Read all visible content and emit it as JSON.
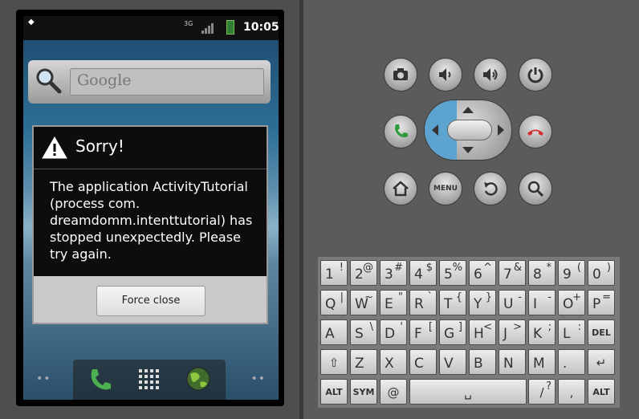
{
  "statusbar": {
    "network": "3G",
    "time": "10:05"
  },
  "search": {
    "placeholder": "Google"
  },
  "dialog": {
    "title": "Sorry!",
    "message": "The application ActivityTutorial (process com. dreamdomm.intenttutorial) has stopped unexpectedly. Please try again.",
    "button": "Force close"
  },
  "controls": {
    "menu_label": "MENU"
  },
  "keyboard": {
    "row1": [
      {
        "main": "1",
        "alt": "!"
      },
      {
        "main": "2",
        "alt": "@"
      },
      {
        "main": "3",
        "alt": "#"
      },
      {
        "main": "4",
        "alt": "$"
      },
      {
        "main": "5",
        "alt": "%"
      },
      {
        "main": "6",
        "alt": "^"
      },
      {
        "main": "7",
        "alt": "&"
      },
      {
        "main": "8",
        "alt": "*"
      },
      {
        "main": "9",
        "alt": "("
      },
      {
        "main": "0",
        "alt": ")"
      }
    ],
    "row2": [
      {
        "main": "Q",
        "alt": "|"
      },
      {
        "main": "W",
        "alt": "~"
      },
      {
        "main": "E",
        "alt": "\""
      },
      {
        "main": "R",
        "alt": "`"
      },
      {
        "main": "T",
        "alt": "{"
      },
      {
        "main": "Y",
        "alt": "}"
      },
      {
        "main": "U",
        "alt": "-"
      },
      {
        "main": "I",
        "alt": "-"
      },
      {
        "main": "O",
        "alt": "+"
      },
      {
        "main": "P",
        "alt": "="
      }
    ],
    "row3": [
      {
        "main": "A",
        "alt": ""
      },
      {
        "main": "S",
        "alt": "\\"
      },
      {
        "main": "D",
        "alt": "'"
      },
      {
        "main": "F",
        "alt": "["
      },
      {
        "main": "G",
        "alt": "]"
      },
      {
        "main": "H",
        "alt": "<"
      },
      {
        "main": "J",
        "alt": ">"
      },
      {
        "main": "K",
        "alt": ";"
      },
      {
        "main": "L",
        "alt": ":"
      },
      {
        "main": "DEL",
        "alt": ""
      }
    ],
    "row4": [
      {
        "main": "⇧",
        "alt": ""
      },
      {
        "main": "Z",
        "alt": ""
      },
      {
        "main": "X",
        "alt": ""
      },
      {
        "main": "C",
        "alt": ""
      },
      {
        "main": "V",
        "alt": ""
      },
      {
        "main": "B",
        "alt": ""
      },
      {
        "main": "N",
        "alt": ""
      },
      {
        "main": "M",
        "alt": ""
      },
      {
        "main": ".",
        "alt": ""
      },
      {
        "main": "↵",
        "alt": ""
      }
    ],
    "row5": {
      "alt_left": "ALT",
      "sym": "SYM",
      "at": "@",
      "space": "␣",
      "slash": "/",
      "slash_alt": "?",
      "comma": ",",
      "alt_right": "ALT"
    }
  }
}
